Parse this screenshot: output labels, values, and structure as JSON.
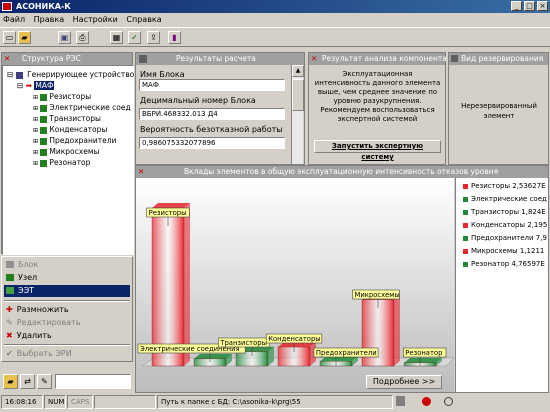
{
  "app": {
    "title": "АСОНИКА-К"
  },
  "menu": [
    "Файл",
    "Правка",
    "Настройки",
    "Справка"
  ],
  "tree": {
    "title": "Структура РЭС",
    "root": "Генерирующее устройство",
    "node": "МАФ",
    "children": [
      "Резисторы",
      "Электрические соед",
      "Транзисторы",
      "Конденсаторы",
      "Предохранители",
      "Микросхемы",
      "Резонатор"
    ]
  },
  "context_menu": [
    "Блок",
    "Узел",
    "ЭЭТ",
    "Размножить",
    "Редактировать",
    "Удалить",
    "Выбрать ЭРИ"
  ],
  "results": {
    "title": "Результаты расчета",
    "block_name_label": "Имя Блока",
    "block_name": "МАФ",
    "decimal_label": "Децимальный номер Блока",
    "decimal": "ВБРИ.468332.013 Д4",
    "prob_label": "Вероятность безотказной работы",
    "prob": "0,986075332077896"
  },
  "analysis": {
    "title": "Результат анализа компонента",
    "text": "Эксплуатационная интенсивность данного элемента выше, чем среднее значение по уровню разукрупнения. Рекомендуем воспользоваться экспертной системой",
    "button": "Запустить экспертную систему"
  },
  "reserve": {
    "title": "Вид резервирования",
    "value": "Нерезервированный элемент"
  },
  "chart_panel": {
    "title": "Вклады элементов в общую эксплуатационную интенсивность отказов уровня",
    "more": "Подробнее >>"
  },
  "chart_data": {
    "type": "bar",
    "title": "Вклады элементов в общую эксплуатационную интенсивность отказов уровня",
    "categories": [
      "Резисторы",
      "Электрические соединения",
      "Транзисторы",
      "Конденсаторы",
      "Предохранители",
      "Микросхемы",
      "Резонатор"
    ],
    "values": [
      1.0,
      0.045,
      0.09,
      0.12,
      0.03,
      0.42,
      0.02
    ],
    "legend": [
      "Резисторы 2,53627E",
      "Электрические соед",
      "Транзисторы 1,824E",
      "Конденсаторы 2,195",
      "Предохранители 7,9",
      "Микросхемы 1,1211",
      "Резонатор 4,76597E"
    ],
    "callouts": [
      "Резисторы",
      "Электрические соединения",
      "Транзисторы",
      "Конденсаторы",
      "Предохранители",
      "Микросхемы",
      "Резонатор"
    ],
    "colors": [
      "#e8262e",
      "#208a3a",
      "#208a3a",
      "#e8262e",
      "#208a3a",
      "#e8262e",
      "#208a3a"
    ]
  },
  "status": {
    "time": "16:08:16",
    "num": "NUM",
    "caps": "CAPS",
    "path": "Путь к папке с БД: C:\\asonika-k\\prg\\55"
  }
}
